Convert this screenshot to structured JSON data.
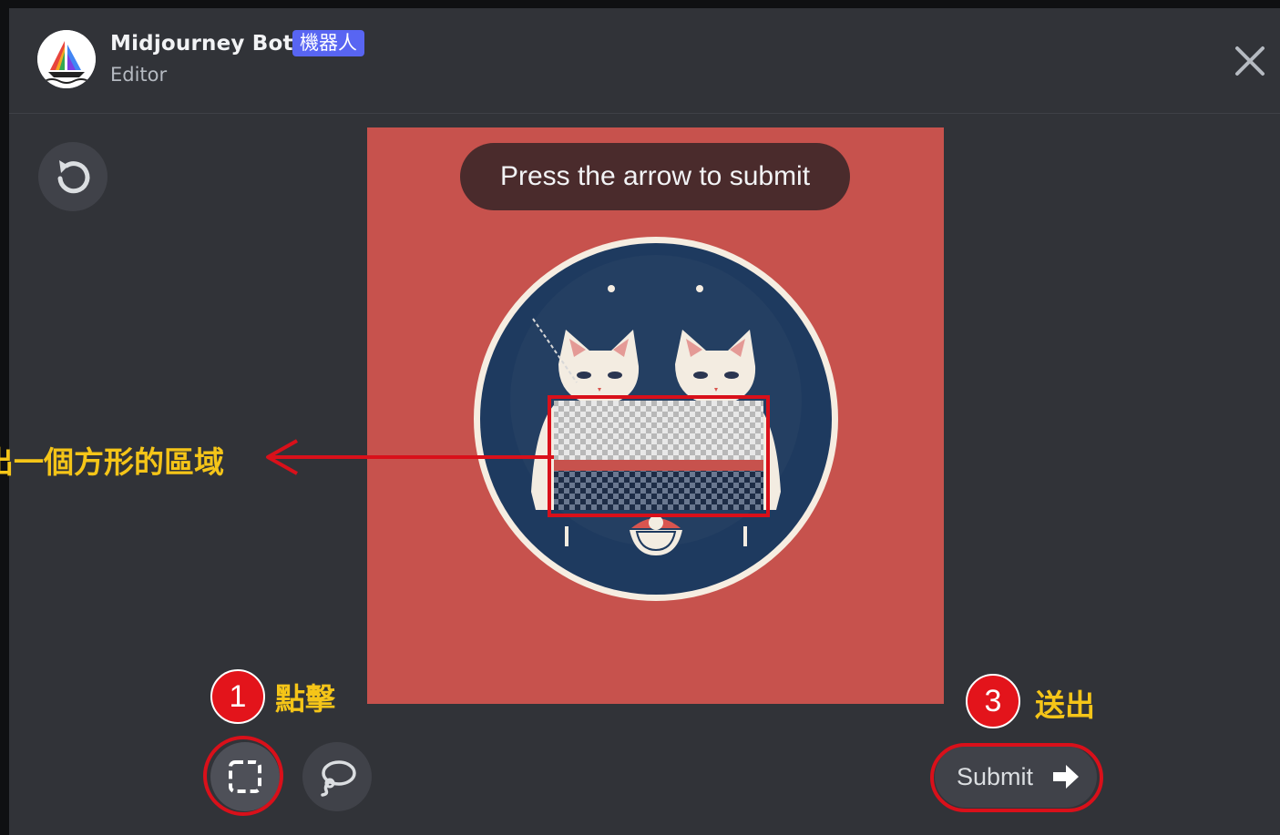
{
  "header": {
    "bot_name": "Midjourney Bot",
    "bot_badge": "機器人",
    "subtitle": "Editor",
    "close_icon": "close-icon"
  },
  "toolbar": {
    "reset_icon": "rotate-ccw-icon",
    "rect_select_icon": "rect-select-icon",
    "lasso_icon": "lasso-icon",
    "submit_label": "Submit",
    "submit_icon": "arrow-right-icon"
  },
  "canvas": {
    "tooltip": "Press the arrow to submit",
    "background_color": "#c7524d",
    "circle_color": "#1e3a5f"
  },
  "annotations": {
    "step1_number": "1",
    "step1_label": "點擊",
    "step2_label": "出一個方形的區域",
    "step3_number": "3",
    "step3_label": "送出",
    "highlight_color": "#d9101a",
    "text_color": "#f5c518"
  }
}
